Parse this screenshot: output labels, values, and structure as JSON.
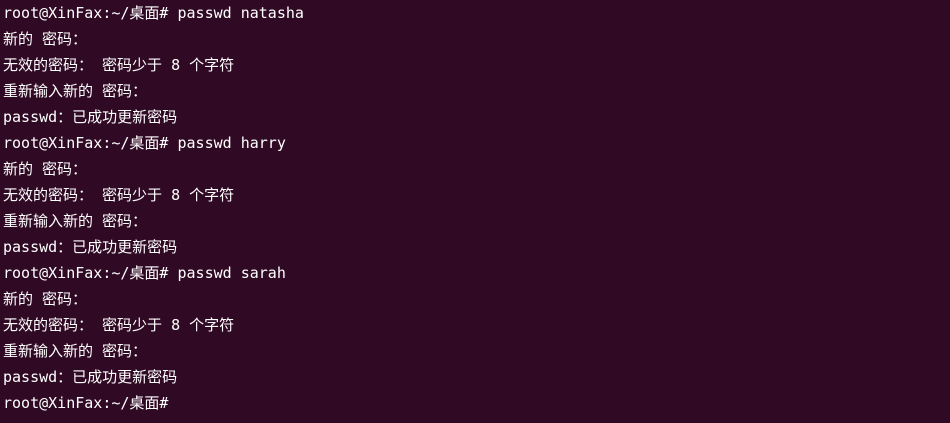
{
  "terminal": {
    "colors": {
      "background": "#300a24",
      "foreground": "#ffffff"
    },
    "lines": [
      "root@XinFax:~/桌面# passwd natasha",
      "新的 密码：",
      "无效的密码： 密码少于 8 个字符",
      "重新输入新的 密码：",
      "passwd：已成功更新密码",
      "root@XinFax:~/桌面# passwd harry",
      "新的 密码：",
      "无效的密码： 密码少于 8 个字符",
      "重新输入新的 密码：",
      "passwd：已成功更新密码",
      "root@XinFax:~/桌面# passwd sarah",
      "新的 密码：",
      "无效的密码： 密码少于 8 个字符",
      "重新输入新的 密码：",
      "passwd：已成功更新密码",
      "root@XinFax:~/桌面#"
    ]
  }
}
